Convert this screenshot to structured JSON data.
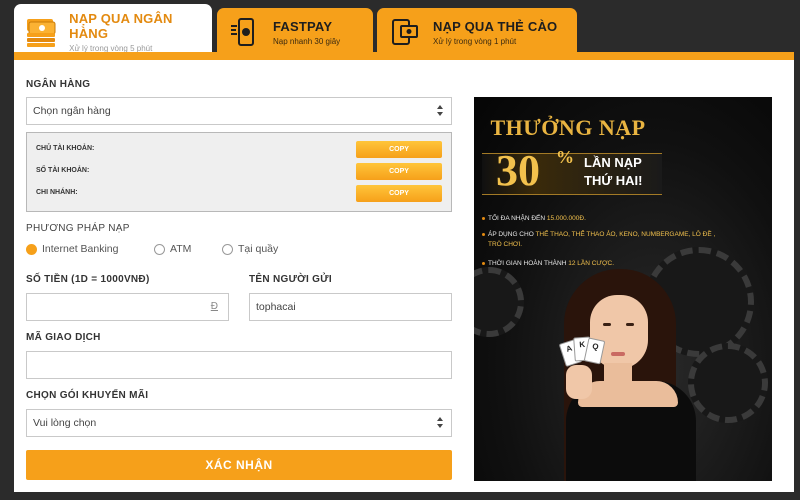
{
  "tabs": [
    {
      "title": "NẠP QUA NGÂN HÀNG",
      "subtitle": "Xử lý trong vòng 5 phút",
      "icon": "money-stack-icon",
      "active": true
    },
    {
      "title": "FASTPAY",
      "subtitle": "Nạp nhanh 30 giây",
      "icon": "mobile-pay-icon",
      "active": false
    },
    {
      "title": "NẠP QUA THẺ CÀO",
      "subtitle": "Xử lý trong vòng 1 phút",
      "icon": "card-phone-icon",
      "active": false
    }
  ],
  "form": {
    "bank_label": "NGÂN HÀNG",
    "bank_select": "Chọn ngân hàng",
    "account_rows": [
      {
        "label": "CHỦ TÀI KHOẢN:",
        "button": "COPY"
      },
      {
        "label": "SỐ TÀI KHOẢN:",
        "button": "COPY"
      },
      {
        "label": "CHI NHÁNH:",
        "button": "COPY"
      }
    ],
    "method_label": "PHƯƠNG PHÁP NẠP",
    "methods": [
      {
        "label": "Internet Banking",
        "selected": true
      },
      {
        "label": "ATM",
        "selected": false
      },
      {
        "label": "Tại quầy",
        "selected": false
      }
    ],
    "amount_label": "SỐ TIỀN (1D = 1000VNĐ)",
    "amount_unit": "Đ",
    "sender_label": "TÊN NGƯỜI GỬI",
    "sender_value": "tophacai",
    "transaction_label": "MÃ GIAO DỊCH",
    "promo_label": "CHỌN GÓI KHUYẾN MÃI",
    "promo_select": "Vui lòng chọn",
    "submit": "XÁC NHẬN"
  },
  "promo": {
    "title": "THƯỞNG NẠP",
    "percent": "30",
    "percent_sign": "%",
    "line1": "LẦN NẠP",
    "line2": "THỨ HAI!",
    "bullets": [
      {
        "text": "TỐI ĐA NHẬN ĐẾN ",
        "highlight": "15.000.000Đ."
      },
      {
        "text": "ÁP DỤNG CHO ",
        "highlight": "THỂ THAO, THỂ THAO ẢO, KENO, NUMBERGAME, LÔ ĐỀ , TRÒ CHƠI."
      },
      {
        "text": "THỜI GIAN HOÀN THÀNH ",
        "highlight": "12 LẦN CƯỢC."
      }
    ],
    "cards": [
      "A",
      "K",
      "Q"
    ]
  },
  "colors": {
    "accent": "#f6a01a",
    "promo_gold": "#f2c14d",
    "background": "#2b2b2b"
  }
}
